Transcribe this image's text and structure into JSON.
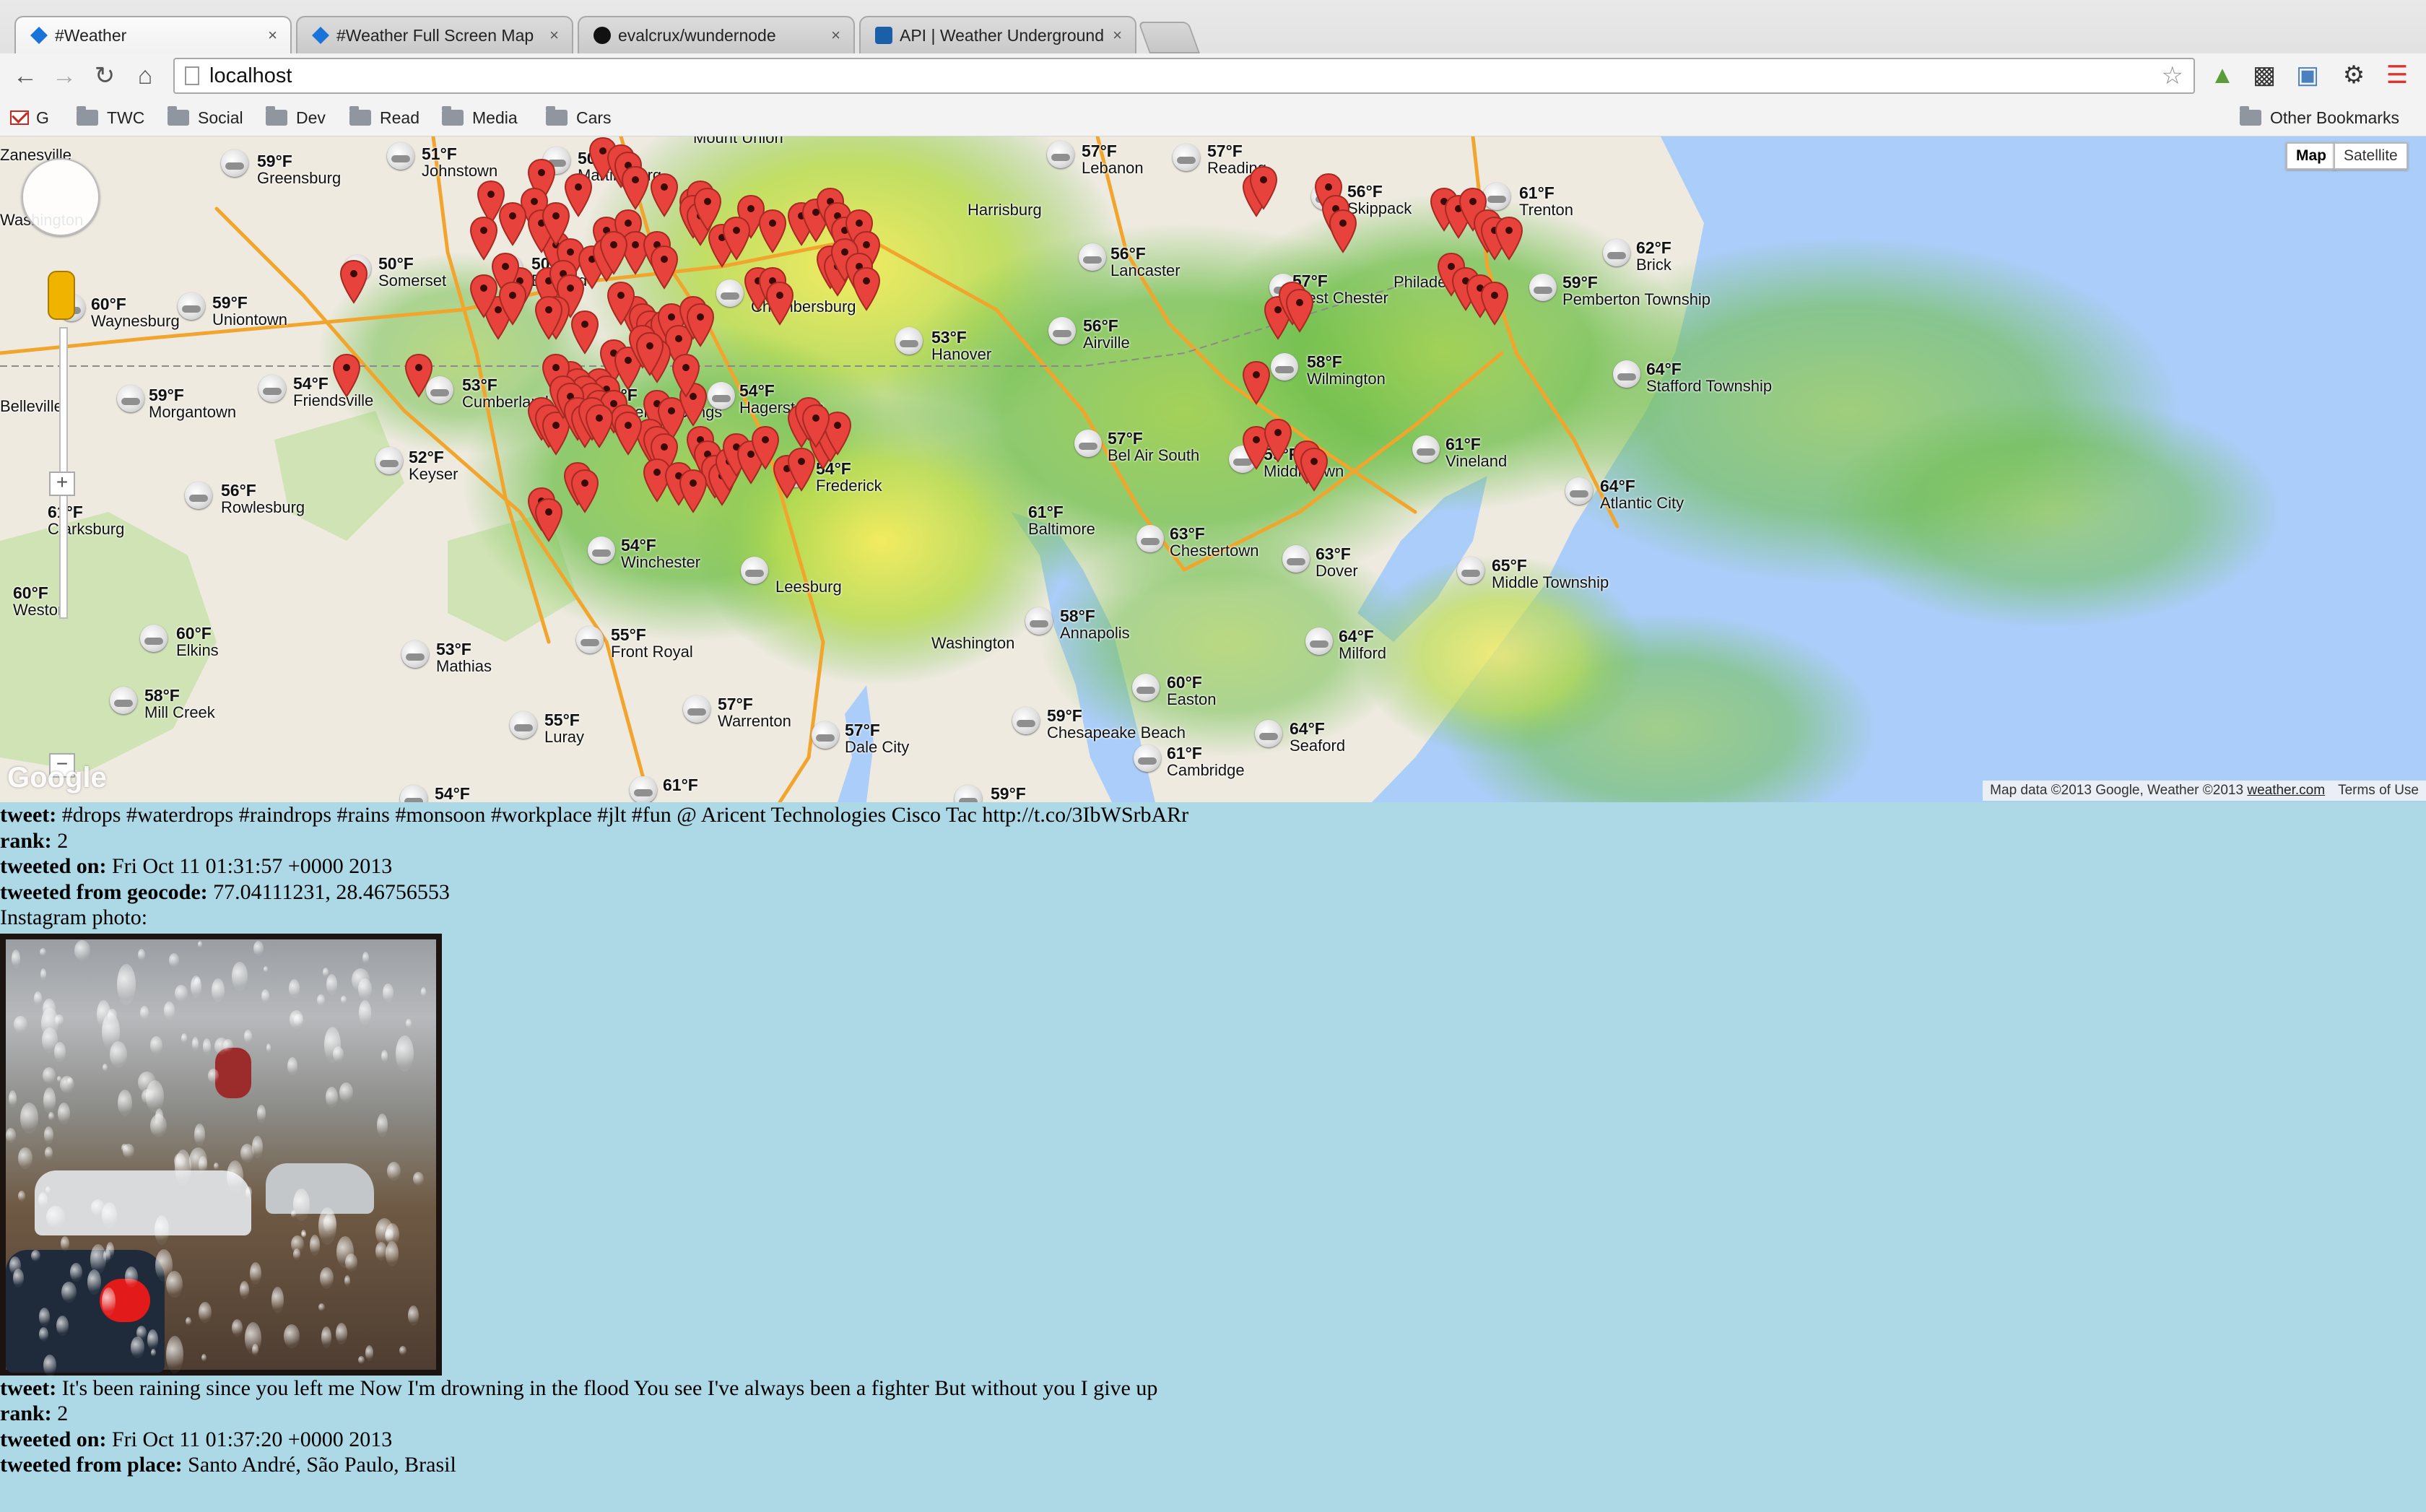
{
  "browser": {
    "tabs": [
      {
        "title": "#Weather",
        "icon": "weather-favicon-icon",
        "active": true
      },
      {
        "title": "#Weather Full Screen Map",
        "icon": "weather-favicon-icon",
        "active": false
      },
      {
        "title": "evalcrux/wundernode",
        "icon": "github-favicon-icon",
        "active": false
      },
      {
        "title": "API | Weather Underground",
        "icon": "wunderground-favicon-icon",
        "active": false
      }
    ],
    "close_glyph": "×",
    "url": "localhost",
    "bookmarks": [
      {
        "label": "G",
        "icon": "gmail-icon"
      },
      {
        "label": "TWC",
        "icon": "folder-icon"
      },
      {
        "label": "Social",
        "icon": "folder-icon"
      },
      {
        "label": "Dev",
        "icon": "folder-icon"
      },
      {
        "label": "Read",
        "icon": "folder-icon"
      },
      {
        "label": "Media",
        "icon": "folder-icon"
      },
      {
        "label": "Cars",
        "icon": "folder-icon"
      }
    ],
    "other_bookmarks": "Other Bookmarks"
  },
  "map": {
    "map_type_buttons": [
      "Map",
      "Satellite"
    ],
    "selected_map_type": "Map",
    "logo": "Google",
    "attribution": "Map data ©2013 Google, Weather ©2013",
    "attribution_link": "weather.com",
    "terms": "Terms of Use",
    "zoom_in": "+",
    "zoom_out": "−",
    "cities": [
      {
        "temp": "",
        "name": "Zanesville"
      },
      {
        "temp": "59°F",
        "name": "Greensburg"
      },
      {
        "temp": "51°F",
        "name": "Johnstown"
      },
      {
        "temp": "50°F",
        "name": "Martinsburg"
      },
      {
        "temp": "",
        "name": "Mount Union"
      },
      {
        "temp": "57°F",
        "name": "Lebanon"
      },
      {
        "temp": "57°F",
        "name": "Reading"
      },
      {
        "temp": "61°F",
        "name": "Trenton"
      },
      {
        "temp": "",
        "name": "Washington"
      },
      {
        "temp": "50°F",
        "name": "Somerset"
      },
      {
        "temp": "50°F",
        "name": "Bedford"
      },
      {
        "temp": "",
        "name": "Harrisburg"
      },
      {
        "temp": "56°F",
        "name": "Lancaster"
      },
      {
        "temp": "56°F",
        "name": "Skippack"
      },
      {
        "temp": "62°F",
        "name": "Brick"
      },
      {
        "temp": "60°F",
        "name": "Waynesburg"
      },
      {
        "temp": "59°F",
        "name": "Uniontown"
      },
      {
        "temp": "53°F",
        "name": "Chambersburg"
      },
      {
        "temp": "53°F",
        "name": "Hanover"
      },
      {
        "temp": "56°F",
        "name": "Airville"
      },
      {
        "temp": "57°F",
        "name": "West Chester"
      },
      {
        "temp": "",
        "name": "Philadelphia"
      },
      {
        "temp": "59°F",
        "name": "Pemberton Township"
      },
      {
        "temp": "54°F",
        "name": "Friendsville"
      },
      {
        "temp": "53°F",
        "name": "Cumberland"
      },
      {
        "temp": "59°F",
        "name": "Morgantown"
      },
      {
        "temp": "51°F",
        "name": "Berkeley Springs"
      },
      {
        "temp": "54°F",
        "name": "Hagerstown"
      },
      {
        "temp": "58°F",
        "name": "Wilmington"
      },
      {
        "temp": "64°F",
        "name": "Stafford Township"
      },
      {
        "temp": "",
        "name": "Belleville"
      },
      {
        "temp": "52°F",
        "name": "Keyser"
      },
      {
        "temp": "57°F",
        "name": "Bel Air South"
      },
      {
        "temp": "59°F",
        "name": "Middletown"
      },
      {
        "temp": "61°F",
        "name": "Vineland"
      },
      {
        "temp": "54°F",
        "name": "Frederick"
      },
      {
        "temp": "56°F",
        "name": "Rowlesburg"
      },
      {
        "temp": "61°F",
        "name": "Clarksburg"
      },
      {
        "temp": "61°F",
        "name": "Baltimore"
      },
      {
        "temp": "64°F",
        "name": "Atlantic City"
      },
      {
        "temp": "54°F",
        "name": "Winchester"
      },
      {
        "temp": "63°F",
        "name": "Chestertown"
      },
      {
        "temp": "63°F",
        "name": "Dover"
      },
      {
        "temp": "65°F",
        "name": "Middle Township"
      },
      {
        "temp": "60°F",
        "name": "Weston"
      },
      {
        "temp": "",
        "name": "Leesburg"
      },
      {
        "temp": "58°F",
        "name": "Annapolis"
      },
      {
        "temp": "60°F",
        "name": "Elkins"
      },
      {
        "temp": "55°F",
        "name": "Front Royal"
      },
      {
        "temp": "",
        "name": "Washington"
      },
      {
        "temp": "64°F",
        "name": "Milford"
      },
      {
        "temp": "53°F",
        "name": "Mathias"
      },
      {
        "temp": "60°F",
        "name": "Easton"
      },
      {
        "temp": "58°F",
        "name": "Mill Creek"
      },
      {
        "temp": "57°F",
        "name": "Warrenton"
      },
      {
        "temp": "59°F",
        "name": "Chesapeake Beach"
      },
      {
        "temp": "64°F",
        "name": "Seaford"
      },
      {
        "temp": "55°F",
        "name": "Luray"
      },
      {
        "temp": "57°F",
        "name": "Dale City"
      },
      {
        "temp": "61°F",
        "name": "Cambridge"
      },
      {
        "temp": "61°F",
        "name": ""
      },
      {
        "temp": "54°F",
        "name": ""
      },
      {
        "temp": "59°F",
        "name": ""
      }
    ],
    "colors": {
      "water": "#abcdf9",
      "land": "#eeeae0",
      "radar_green": "#6fbf4a",
      "radar_yellow": "#f4ec5a",
      "pin": "#e8423c"
    }
  },
  "feed": {
    "posts": [
      {
        "tweet_label": "tweet:",
        "tweet": "#drops #waterdrops #raindrops #rains #monsoon #workplace #jlt #fun @ Aricent Technologies Cisco Tac http://t.co/3IbWSrbARr",
        "rank_label": "rank:",
        "rank": "2",
        "date_label": "tweeted on:",
        "date": "Fri Oct 11 01:31:57 +0000 2013",
        "loc_label": "tweeted from geocode:",
        "loc": "77.04111231, 28.46756553",
        "photo_label": "Instagram photo:"
      },
      {
        "tweet_label": "tweet:",
        "tweet": "It's been raining since you left me Now I'm drowning in the flood You see I've always been a fighter But without you I give up",
        "rank_label": "rank:",
        "rank": "2",
        "date_label": "tweeted on:",
        "date": "Fri Oct 11 01:37:20 +0000 2013",
        "loc_label": "tweeted from place:",
        "loc": "Santo André, São Paulo, Brasil"
      }
    ]
  }
}
